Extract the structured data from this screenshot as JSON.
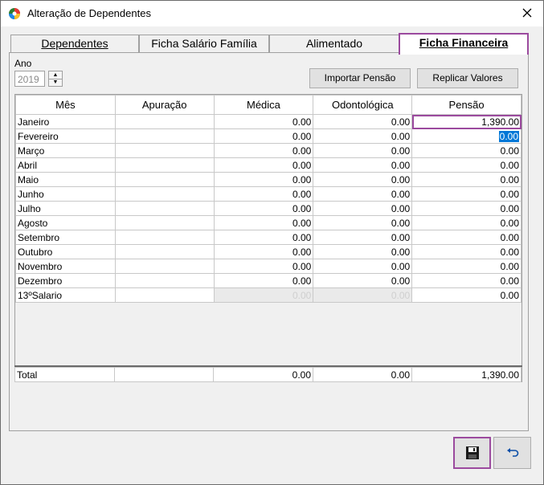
{
  "window": {
    "title": "Alteração de Dependentes"
  },
  "tabs": [
    {
      "label": "Dependentes",
      "active": false
    },
    {
      "label": "Ficha Salário Família",
      "active": false
    },
    {
      "label": "Alimentado",
      "active": false
    },
    {
      "label": "Ficha Financeira",
      "active": true
    }
  ],
  "ano": {
    "label": "Ano",
    "value": "2019"
  },
  "buttons": {
    "importar": "Importar Pensão",
    "replicar": "Replicar Valores"
  },
  "grid": {
    "columns": [
      "Mês",
      "Apuração",
      "Médica",
      "Odontológica",
      "Pensão"
    ],
    "rows": [
      {
        "mes": "Janeiro",
        "apuracao": "",
        "medica": "0.00",
        "odonto": "0.00",
        "pensao": "1,390.00"
      },
      {
        "mes": "Fevereiro",
        "apuracao": "",
        "medica": "0.00",
        "odonto": "0.00",
        "pensao": "0.00"
      },
      {
        "mes": "Março",
        "apuracao": "",
        "medica": "0.00",
        "odonto": "0.00",
        "pensao": "0.00"
      },
      {
        "mes": "Abril",
        "apuracao": "",
        "medica": "0.00",
        "odonto": "0.00",
        "pensao": "0.00"
      },
      {
        "mes": "Maio",
        "apuracao": "",
        "medica": "0.00",
        "odonto": "0.00",
        "pensao": "0.00"
      },
      {
        "mes": "Junho",
        "apuracao": "",
        "medica": "0.00",
        "odonto": "0.00",
        "pensao": "0.00"
      },
      {
        "mes": "Julho",
        "apuracao": "",
        "medica": "0.00",
        "odonto": "0.00",
        "pensao": "0.00"
      },
      {
        "mes": "Agosto",
        "apuracao": "",
        "medica": "0.00",
        "odonto": "0.00",
        "pensao": "0.00"
      },
      {
        "mes": "Setembro",
        "apuracao": "",
        "medica": "0.00",
        "odonto": "0.00",
        "pensao": "0.00"
      },
      {
        "mes": "Outubro",
        "apuracao": "",
        "medica": "0.00",
        "odonto": "0.00",
        "pensao": "0.00"
      },
      {
        "mes": "Novembro",
        "apuracao": "",
        "medica": "0.00",
        "odonto": "0.00",
        "pensao": "0.00"
      },
      {
        "mes": "Dezembro",
        "apuracao": "",
        "medica": "0.00",
        "odonto": "0.00",
        "pensao": "0.00"
      },
      {
        "mes": "13ºSalario",
        "apuracao": "",
        "medica": "0.00",
        "odonto": "0.00",
        "pensao": "0.00"
      }
    ],
    "total": {
      "label": "Total",
      "apuracao": "",
      "medica": "0.00",
      "odonto": "0.00",
      "pensao": "1,390.00"
    }
  },
  "icons": {
    "app": "app-icon",
    "close": "close-icon",
    "save": "floppy-disk-icon",
    "undo": "undo-icon"
  },
  "colors": {
    "accent": "#9b4a9e",
    "selection": "#0078d7"
  }
}
